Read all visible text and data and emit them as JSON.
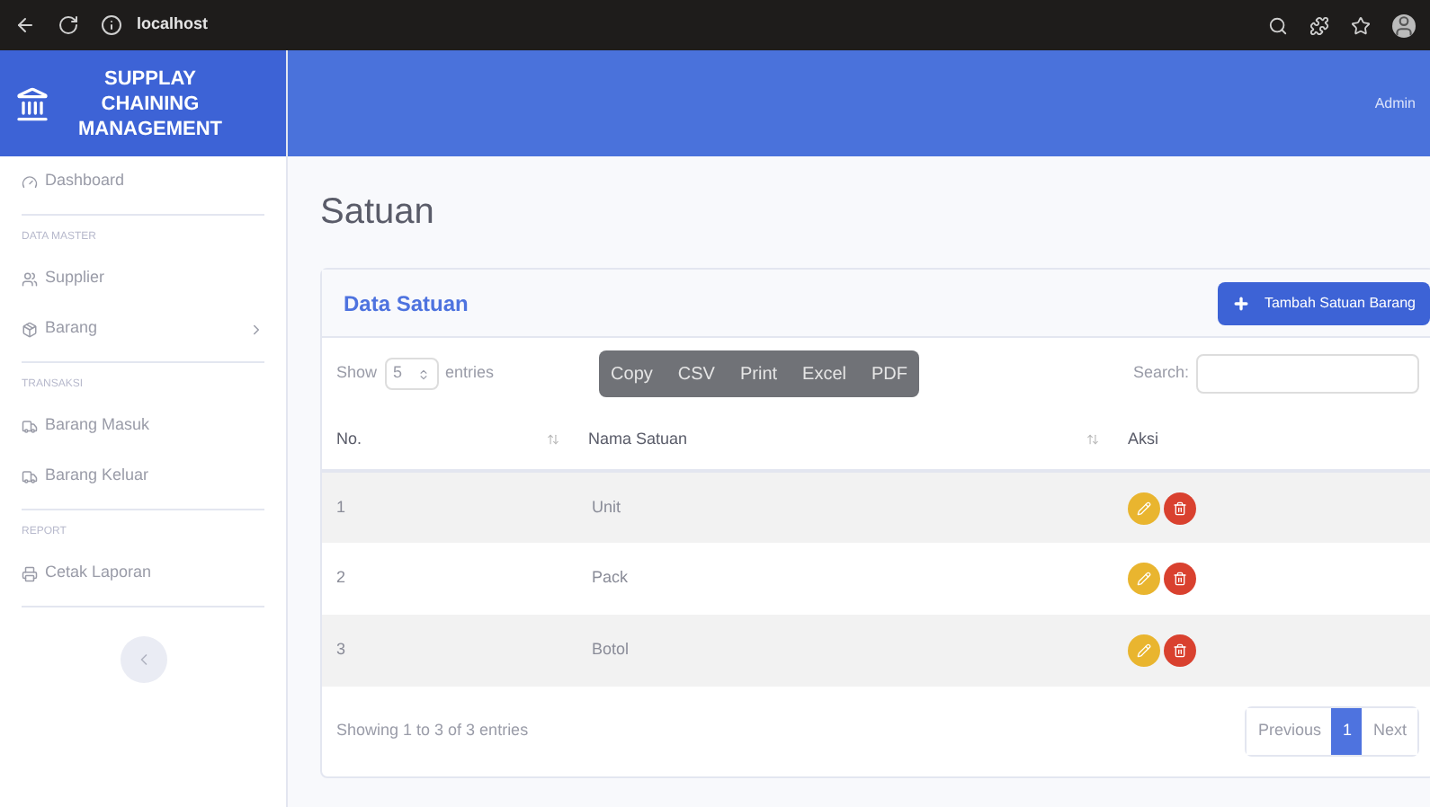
{
  "browser": {
    "url_host": "localhost"
  },
  "brand": {
    "title": "SUPPLAY CHAINING MANAGEMENT"
  },
  "topbar": {
    "user": "Admin"
  },
  "sidebar": {
    "items": [
      {
        "kind": "item",
        "label": "Dashboard",
        "expandable": false
      },
      {
        "kind": "heading",
        "label": "DATA MASTER"
      },
      {
        "kind": "item",
        "label": "Supplier",
        "expandable": false
      },
      {
        "kind": "item",
        "label": "Barang",
        "expandable": true
      },
      {
        "kind": "heading",
        "label": "TRANSAKSI"
      },
      {
        "kind": "item",
        "label": "Barang Masuk",
        "expandable": false
      },
      {
        "kind": "item",
        "label": "Barang Keluar",
        "expandable": false
      },
      {
        "kind": "heading",
        "label": "REPORT"
      },
      {
        "kind": "item",
        "label": "Cetak Laporan",
        "expandable": false
      }
    ]
  },
  "page_title": "Satuan",
  "card": {
    "title": "Data Satuan",
    "add_button": "Tambah Satuan Barang",
    "length": {
      "show": "Show",
      "value": "5",
      "entries": "entries"
    },
    "export_buttons": [
      "Copy",
      "CSV",
      "Print",
      "Excel",
      "PDF"
    ],
    "search_label": "Search:",
    "table": {
      "columns": [
        "No.",
        "Nama Satuan",
        "Aksi"
      ],
      "rows": [
        {
          "no": "1",
          "name": "Unit"
        },
        {
          "no": "2",
          "name": "Pack"
        },
        {
          "no": "3",
          "name": "Botol"
        }
      ]
    },
    "info": "Showing 1 to 3 of 3 entries",
    "pagination": [
      {
        "label": "Previous",
        "selected": false
      },
      {
        "label": "1",
        "selected": true
      },
      {
        "label": "Next",
        "selected": false
      }
    ]
  }
}
